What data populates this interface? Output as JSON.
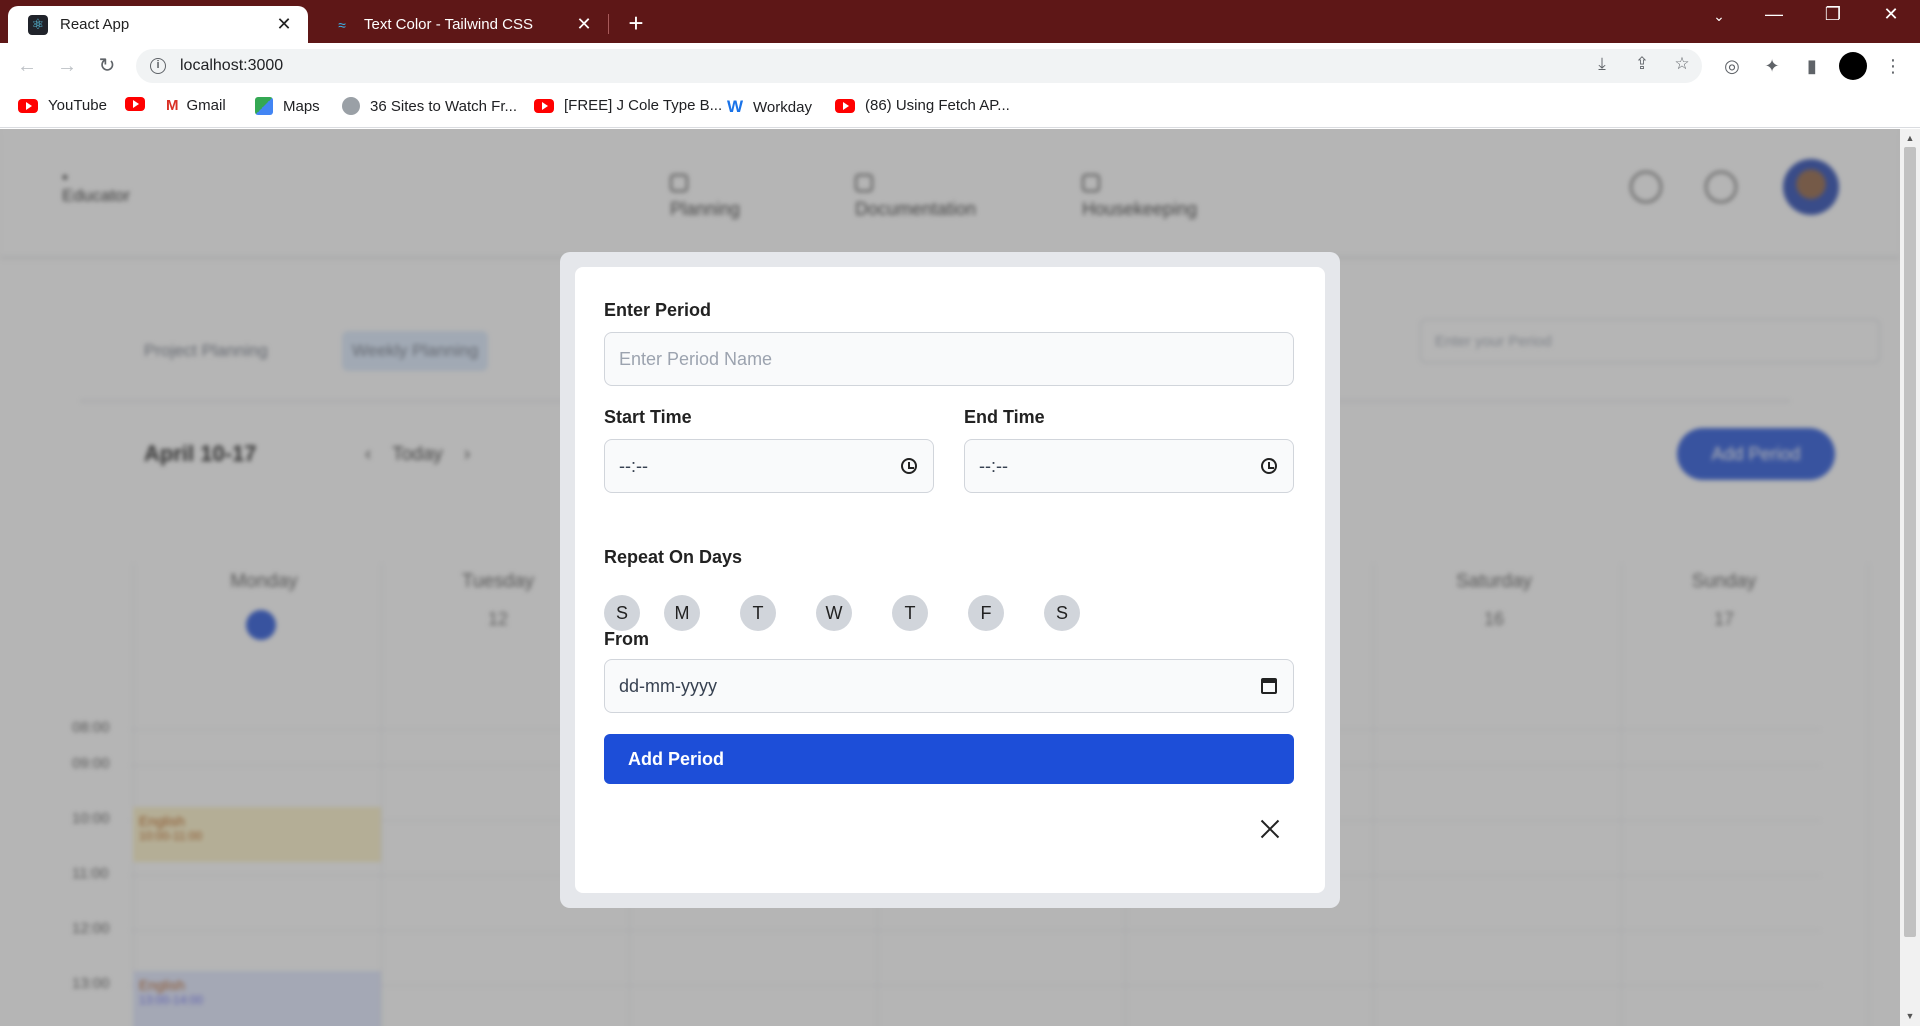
{
  "browser": {
    "tabs": [
      {
        "title": "React App",
        "active": true,
        "favicon": "react-icon"
      },
      {
        "title": "Text Color - Tailwind CSS",
        "active": false,
        "favicon": "tailwind-icon"
      }
    ],
    "url": "localhost:3000",
    "bookmarks": [
      {
        "label": "YouTube",
        "icon": "youtube-icon"
      },
      {
        "label": "",
        "icon": "youtube-icon"
      },
      {
        "label": "Gmail",
        "icon": "gmail-icon"
      },
      {
        "label": "Maps",
        "icon": "maps-icon"
      },
      {
        "label": "36 Sites to Watch Fr...",
        "icon": "globe-icon"
      },
      {
        "label": "[FREE] J Cole Type B...",
        "icon": "youtube-icon"
      },
      {
        "label": "Workday",
        "icon": "workday-icon"
      },
      {
        "label": "(86) Using Fetch AP...",
        "icon": "youtube-icon"
      }
    ]
  },
  "app": {
    "brand": "Educator",
    "nav": [
      "Planning",
      "Documentation",
      "Housekeeping"
    ],
    "subtabs": [
      "Project Planning",
      "Weekly Planning"
    ],
    "search_placeholder": "Enter your Period",
    "week_title": "April 10-17",
    "today_label": "Today",
    "add_period": "Add Period",
    "days": [
      {
        "name": "Monday",
        "num": ""
      },
      {
        "name": "Tuesday",
        "num": "12"
      },
      {
        "name": "",
        "num": ""
      },
      {
        "name": "",
        "num": ""
      },
      {
        "name": "",
        "num": ""
      },
      {
        "name": "Saturday",
        "num": "16"
      },
      {
        "name": "Sunday",
        "num": "17"
      }
    ],
    "hours": [
      "08:00",
      "09:00",
      "10:00",
      "11:00",
      "12:00",
      "13:00"
    ],
    "events": [
      {
        "title": "English",
        "time": "10:00-11:00"
      },
      {
        "title": "English",
        "time": "13:00-14:00"
      }
    ]
  },
  "modal": {
    "period_label": "Enter Period",
    "period_placeholder": "Enter Period Name",
    "start_label": "Start Time",
    "start_value": "--:--",
    "end_label": "End Time",
    "end_value": "--:--",
    "repeat_label": "Repeat On Days",
    "weekdays": [
      "S",
      "M",
      "T",
      "W",
      "T",
      "F",
      "S"
    ],
    "from_label": "From",
    "from_value": "dd-mm-yyyy",
    "submit_label": "Add Period"
  },
  "colors": {
    "tabbar": "#5e1717",
    "primary": "#1d4ed8",
    "overlay": "rgba(90,90,90,0.45)"
  }
}
